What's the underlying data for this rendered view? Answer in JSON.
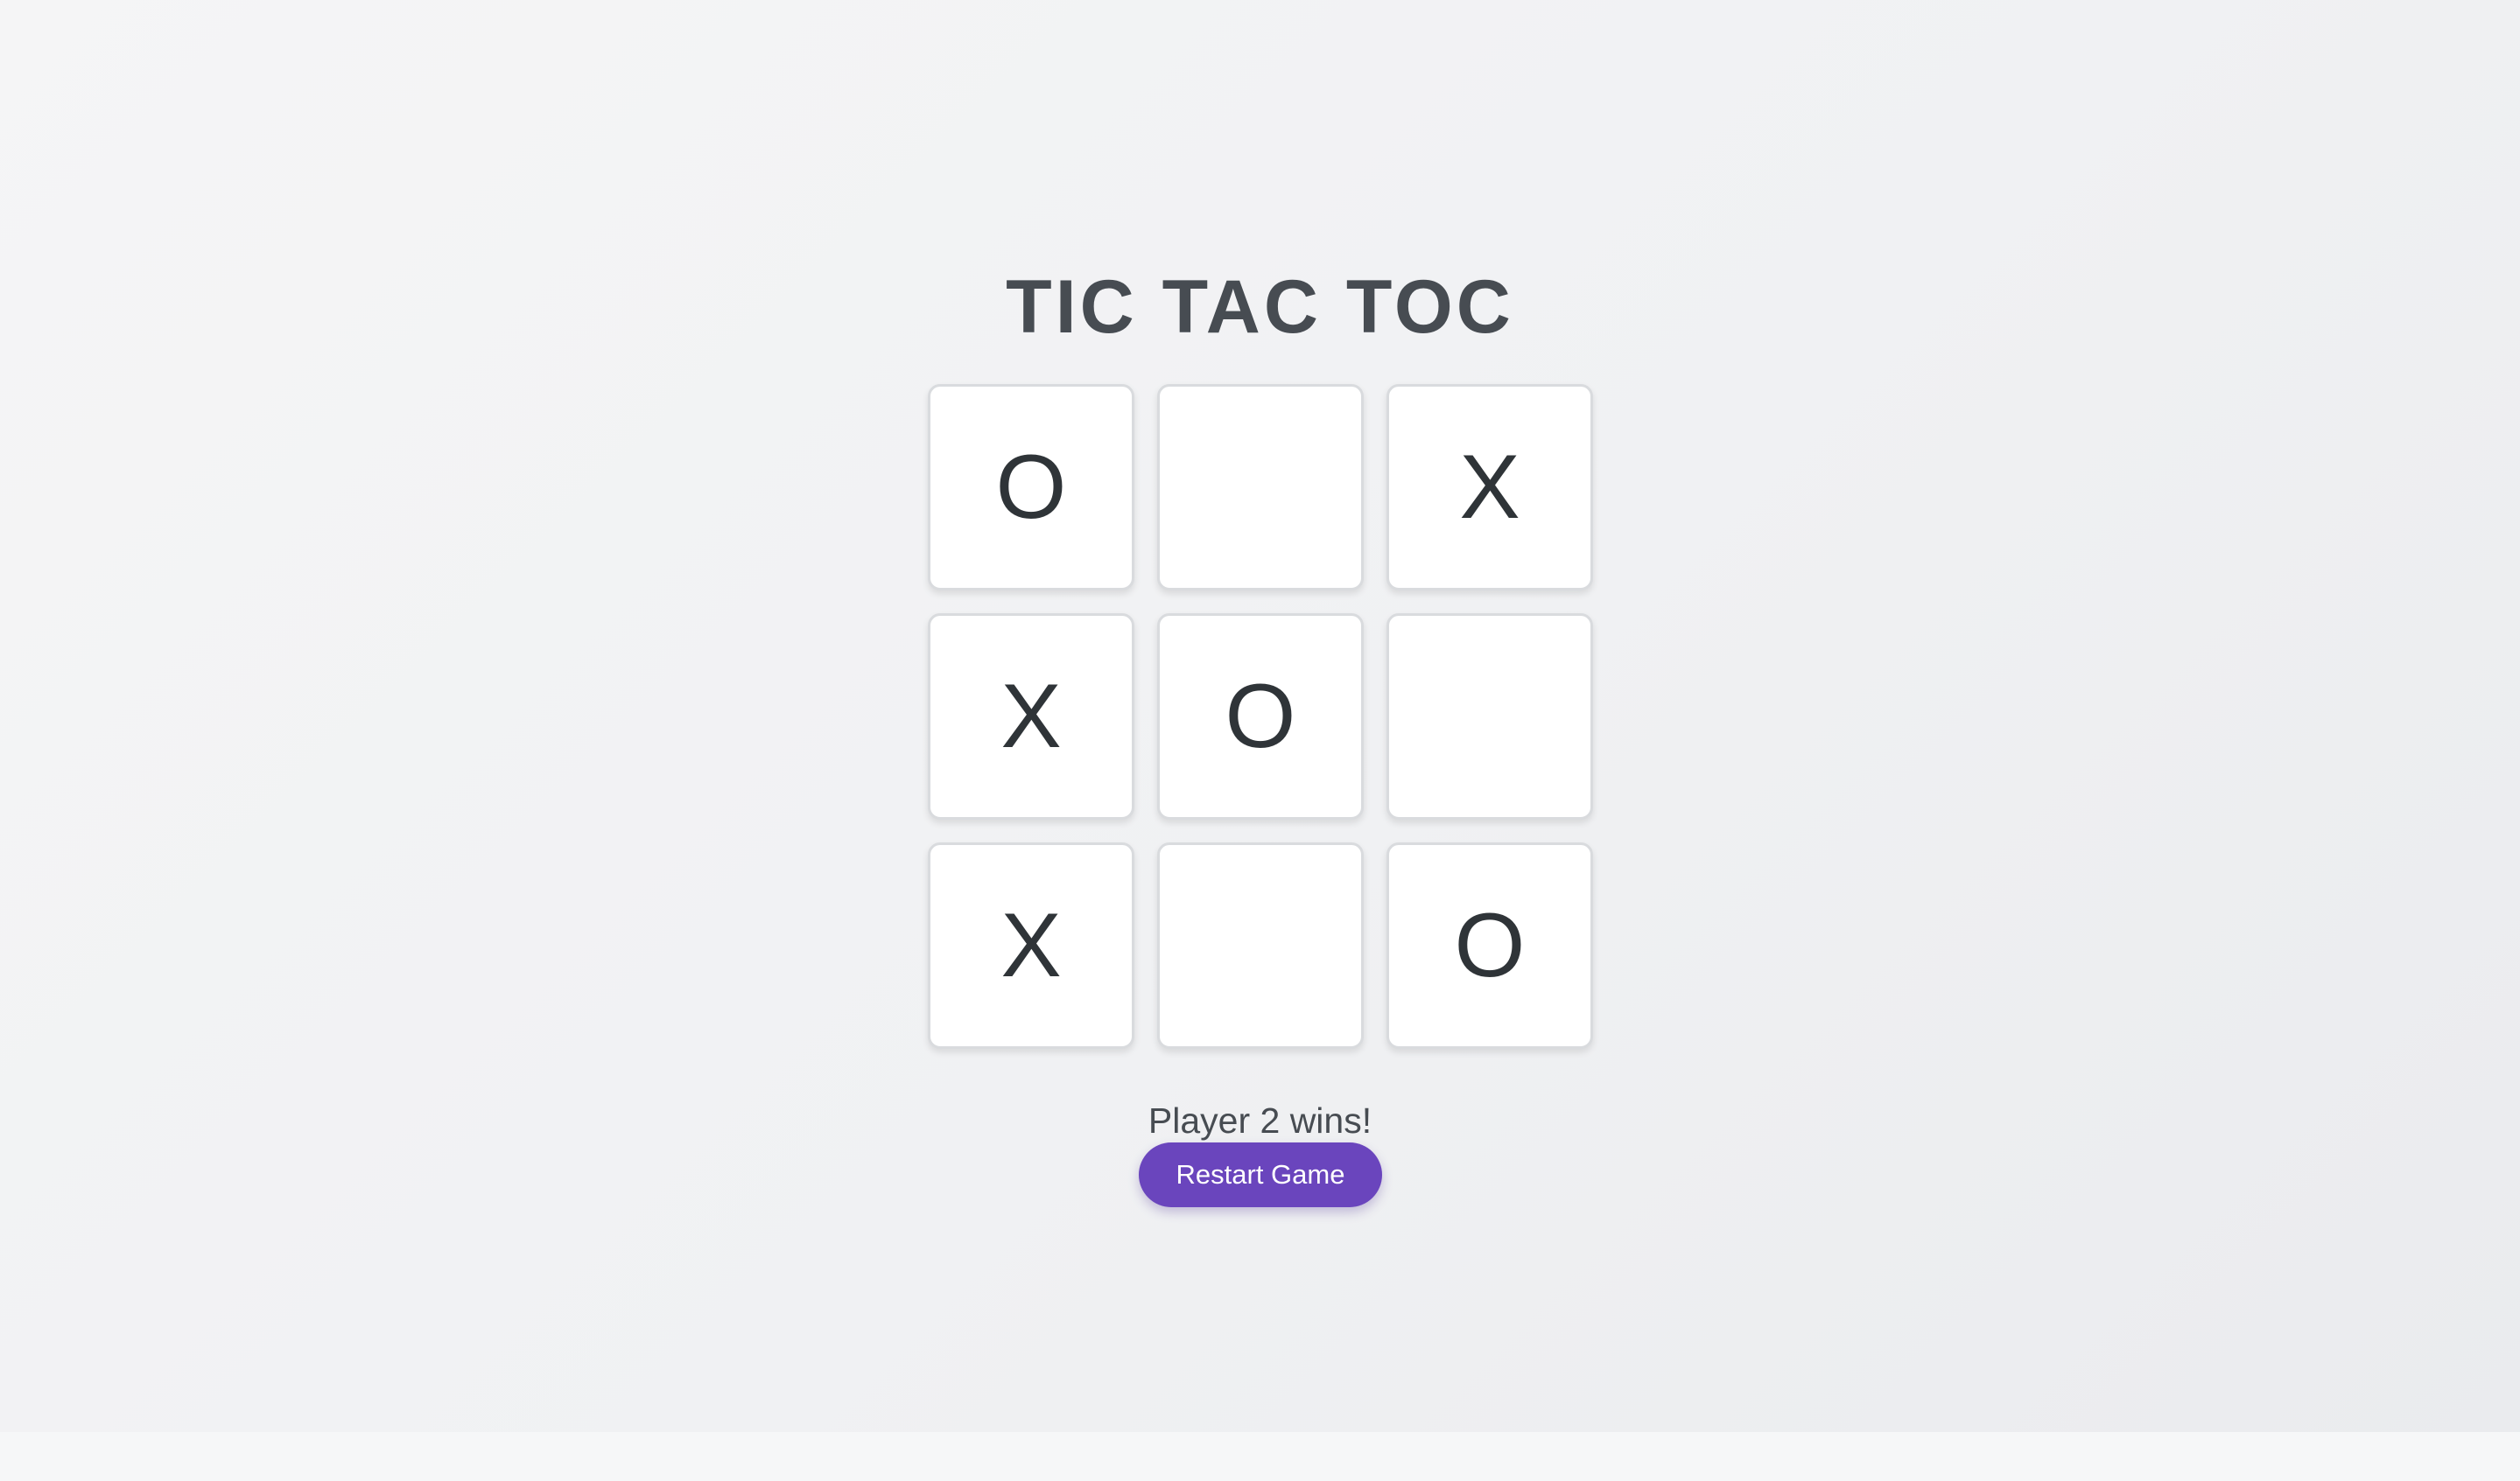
{
  "game": {
    "title": "TIC TAC TOC",
    "board": [
      {
        "mark": "O"
      },
      {
        "mark": ""
      },
      {
        "mark": "X"
      },
      {
        "mark": "X"
      },
      {
        "mark": "O"
      },
      {
        "mark": ""
      },
      {
        "mark": "X"
      },
      {
        "mark": ""
      },
      {
        "mark": "O"
      }
    ],
    "status": "Player 2 wins!",
    "restart_label": "Restart Game"
  },
  "colors": {
    "accent": "#6a45bd",
    "title_text": "#474c52",
    "mark_text": "#2f3438",
    "cell_background": "#ffffff",
    "cell_border": "#d9dbde",
    "page_background": "#f2f3f5"
  }
}
